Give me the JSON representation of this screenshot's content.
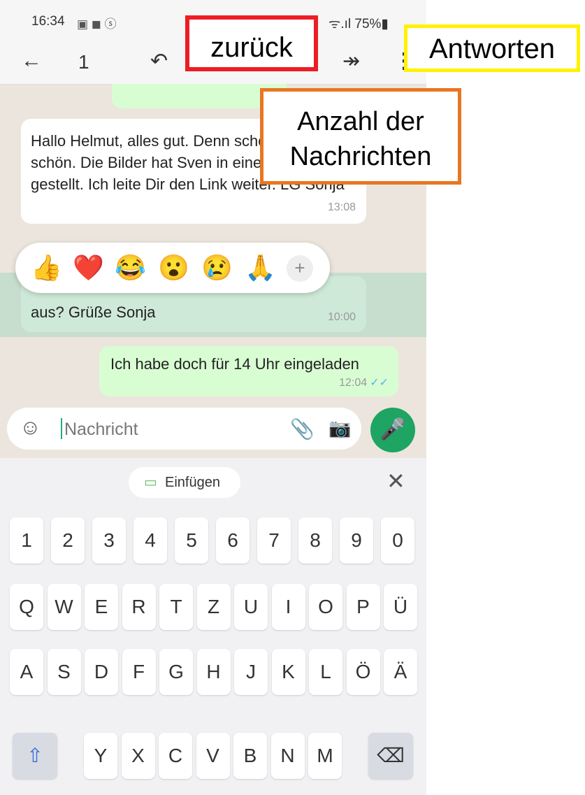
{
  "status": {
    "time": "16:34",
    "icons": "▣ ◼ ⓢ",
    "battery": "ᯤ.ıl 75%▮"
  },
  "actionbar": {
    "back": "←",
    "count": "1",
    "reply": "↶",
    "forward": "↠",
    "more": "⋮"
  },
  "messages": [
    {
      "text": "Hallo Helmut, alles gut. Denn schön🎂! Feiert schön. Die Bilder hat Sven in eine Dropbox gestellt. Ich leite Dir den Link weiter. LG Sonja",
      "time": "13:08"
    },
    {
      "text": "aus? Grüße Sonja",
      "time": "10:00"
    },
    {
      "text": "Ich habe doch für 14 Uhr eingeladen",
      "time": "12:04",
      "ticks": "✓✓"
    }
  ],
  "reactions": [
    "👍",
    "❤️",
    "😂",
    "😮",
    "😢",
    "🙏"
  ],
  "reactions_more": "+",
  "input": {
    "placeholder": "Nachricht",
    "emoji": "☺",
    "attach": "📎",
    "camera": "📷",
    "mic": "🎤"
  },
  "keyboard": {
    "paste": "Einfügen",
    "close": "✕",
    "row1": [
      "1",
      "2",
      "3",
      "4",
      "5",
      "6",
      "7",
      "8",
      "9",
      "0"
    ],
    "row2": [
      "Q",
      "W",
      "E",
      "R",
      "T",
      "Z",
      "U",
      "I",
      "O",
      "P",
      "Ü"
    ],
    "row3": [
      "A",
      "S",
      "D",
      "F",
      "G",
      "H",
      "J",
      "K",
      "L",
      "Ö",
      "Ä"
    ],
    "row4": [
      "Y",
      "X",
      "C",
      "V",
      "B",
      "N",
      "M"
    ],
    "shift": "⇧",
    "backspace": "⌫"
  },
  "annotations": {
    "red": "zurück",
    "yellow": "Antworten",
    "orange": "Anzahl der Nachrichten"
  },
  "colors": {
    "red": "#ee1c24",
    "yellow": "#fff200",
    "orange": "#e87722",
    "whatsapp_green": "#1ea463"
  }
}
